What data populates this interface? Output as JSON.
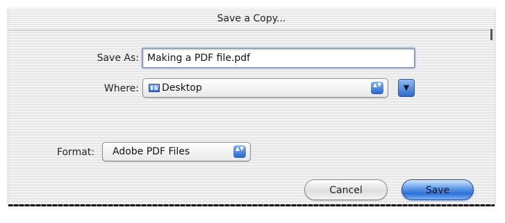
{
  "dialog": {
    "title": "Save a Copy...",
    "save_as": {
      "label": "Save As:",
      "value": "Making a PDF file.pdf"
    },
    "where": {
      "label": "Where:",
      "selected": "Desktop",
      "icon": "folder-icon"
    },
    "format": {
      "label": "Format:",
      "selected": "Adobe PDF Files"
    },
    "buttons": {
      "cancel": "Cancel",
      "save": "Save"
    },
    "glyphs": {
      "popup_arrows": "▲▼",
      "disclosure": "▼"
    }
  },
  "colors": {
    "accent_blue": "#2c6fd6",
    "focus_ring": "#a9c4e6"
  }
}
